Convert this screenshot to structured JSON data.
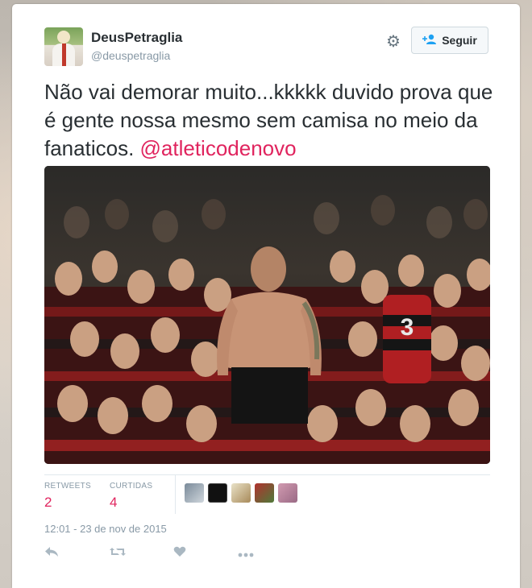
{
  "user": {
    "display_name": "DeusPetraglia",
    "handle": "@deuspetraglia"
  },
  "follow_button": {
    "label": "Seguir"
  },
  "tweet": {
    "text": "Não vai demorar muito...kkkkk duvido prova que é gente nossa mesmo sem camisa no meio da fanaticos. ",
    "mention": "@atleticodenovo"
  },
  "stats": {
    "retweets_label": "RETWEETS",
    "retweets_count": "2",
    "likes_label": "CURTIDAS",
    "likes_count": "4"
  },
  "timestamp": "12:01 - 23 de nov de 2015",
  "colors": {
    "accent": "#e0245e",
    "follow_icon": "#1da1f2",
    "muted_text": "#8899a6"
  },
  "icons": {
    "gear": "gear-icon",
    "follow": "follow-user-icon",
    "reply": "reply-icon",
    "retweet": "retweet-icon",
    "like": "heart-icon",
    "more": "more-icon"
  }
}
